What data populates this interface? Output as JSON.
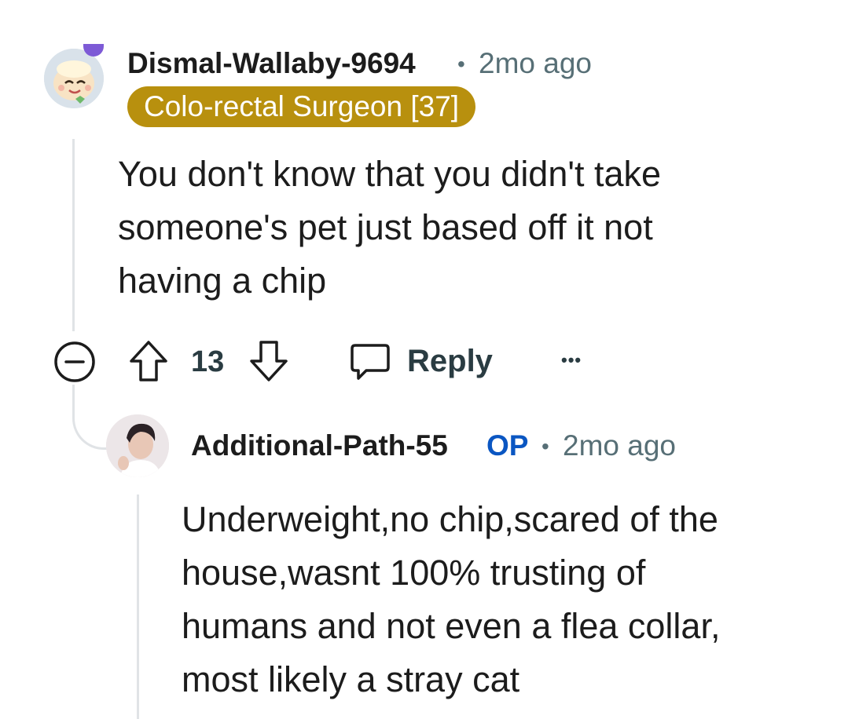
{
  "comment": {
    "username": "Dismal-Wallaby-9694",
    "separator": "•",
    "timestamp": "2mo ago",
    "flair": "Colo-rectal Surgeon [37]",
    "body_lines": [
      "You don't know that you didn't take",
      "someone's pet just based off it not",
      "having a chip"
    ],
    "score": "13",
    "reply_label": "Reply",
    "more_label": "•••"
  },
  "reply": {
    "username": "Additional-Path-55",
    "op_badge": "OP",
    "separator": "•",
    "timestamp": "2mo ago",
    "body_lines": [
      "Underweight,no chip,scared of the",
      "house,wasnt 100% trusting of",
      "humans and not even a flea collar,",
      "most likely a stray cat"
    ]
  },
  "colors": {
    "flair_bg": "#b8900e",
    "op_blue": "#0a56c2",
    "meta_gray": "#576f76",
    "thread_line": "#e0e3e6"
  },
  "icons": {
    "collapse": "minus-circle-icon",
    "upvote": "arrow-up-icon",
    "downvote": "arrow-down-icon",
    "reply": "speech-bubble-icon",
    "more": "ellipsis-icon"
  }
}
